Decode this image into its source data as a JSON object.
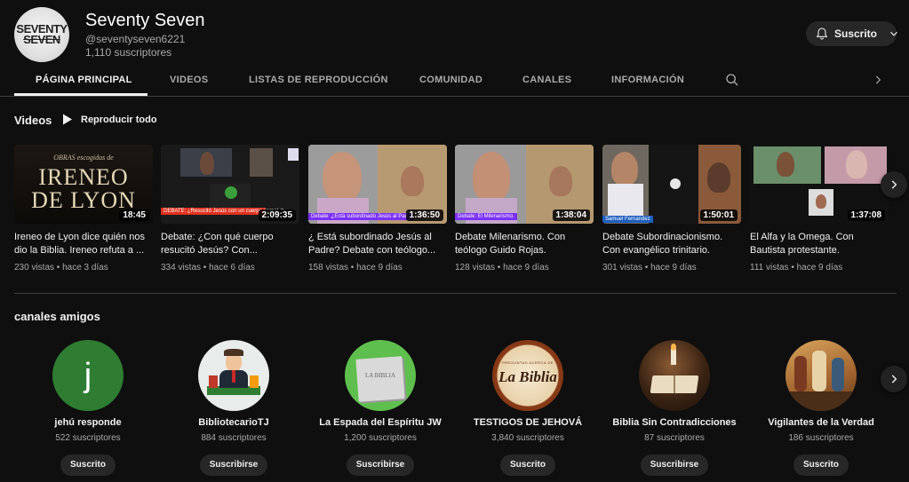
{
  "channel": {
    "avatar_text_1": "SEVENTY",
    "avatar_text_2": "SEVEN",
    "name": "Seventy Seven",
    "handle": "@seventyseven6221",
    "subscribers": "1,110 suscriptores",
    "subscribe_label": "Suscrito"
  },
  "tabs": [
    {
      "label": "PÁGINA PRINCIPAL",
      "active": true
    },
    {
      "label": "VIDEOS"
    },
    {
      "label": "LISTAS DE REPRODUCCIÓN"
    },
    {
      "label": "COMUNIDAD"
    },
    {
      "label": "CANALES"
    },
    {
      "label": "INFORMACIÓN"
    }
  ],
  "videos_section": {
    "title": "Videos",
    "play_all": "Reproducir todo",
    "items": [
      {
        "title": "Ireneo de Lyon dice quién nos dio la Biblia. Ireneo refuta a ...",
        "meta": "230 vistas • hace 3 días",
        "duration": "18:45",
        "thumb_line1": "OBRAS escogidas de",
        "thumb_line2": "IRENEO",
        "thumb_line3": "DE LYON"
      },
      {
        "title": "Debate: ¿Con qué cuerpo resucitó Jesús? Con...",
        "meta": "334 vistas • hace 6 días",
        "duration": "2:09:35",
        "thumb_banner": "DEBATE: ¿Resucitó Jesús con un cuerpo carnal, b..."
      },
      {
        "title": "¿ Está subordinado Jesús al Padre? Debate con teólogo...",
        "meta": "158 vistas • hace 9 días",
        "duration": "1:36:50",
        "thumb_banner": "Debate: ¿Está subordinado Jesús al Pad..."
      },
      {
        "title": "Debate Milenarismo. Con teólogo Guido Rojas.",
        "meta": "128 vistas • hace 9 días",
        "duration": "1:38:04",
        "thumb_banner": "Debate: El Milenarismo."
      },
      {
        "title": "Debate Subordinacionismo. Con evangélico trinitario.",
        "meta": "301 vistas • hace 9 días",
        "duration": "1:50:01",
        "thumb_banner": "Samuel Fernandez"
      },
      {
        "title": "El Alfa y la Omega. Con Bautista protestante.",
        "meta": "111 vistas • hace 9 días",
        "duration": "1:37:08",
        "thumb_banner": ""
      }
    ]
  },
  "friends_section": {
    "title": "canales amigos",
    "items": [
      {
        "name": "jehú responde",
        "subs": "522 suscriptores",
        "button": "Suscrito",
        "initial": "j"
      },
      {
        "name": "BibliotecarioTJ",
        "subs": "884 suscriptores",
        "button": "Suscribirse"
      },
      {
        "name": "La Espada del Espíritu JW",
        "subs": "1,200 suscriptores",
        "button": "Suscribirse",
        "avatar_text": "LA BIBLIA"
      },
      {
        "name": "TESTIGOS DE JEHOVÁ",
        "subs": "3,840 suscriptores",
        "button": "Suscrito",
        "avatar_text_1": "PREGUNTAS ACERCA DE",
        "avatar_text_2": "La Biblia"
      },
      {
        "name": "Biblia Sin Contradicciones",
        "subs": "87 suscriptores",
        "button": "Suscribirse"
      },
      {
        "name": "Vigilantes de la Verdad",
        "subs": "186 suscriptores",
        "button": "Suscrito"
      }
    ]
  },
  "colors": {
    "background": "#0f0f0f",
    "button_bg": "#272727",
    "text_secondary": "#aaaaaa",
    "debate_banner": "#7b2ff7",
    "debate_banner_red": "#e0321f"
  },
  "icons": [
    "bell-icon",
    "chevron-down-icon",
    "search-icon",
    "chevron-right-icon",
    "play-icon"
  ]
}
